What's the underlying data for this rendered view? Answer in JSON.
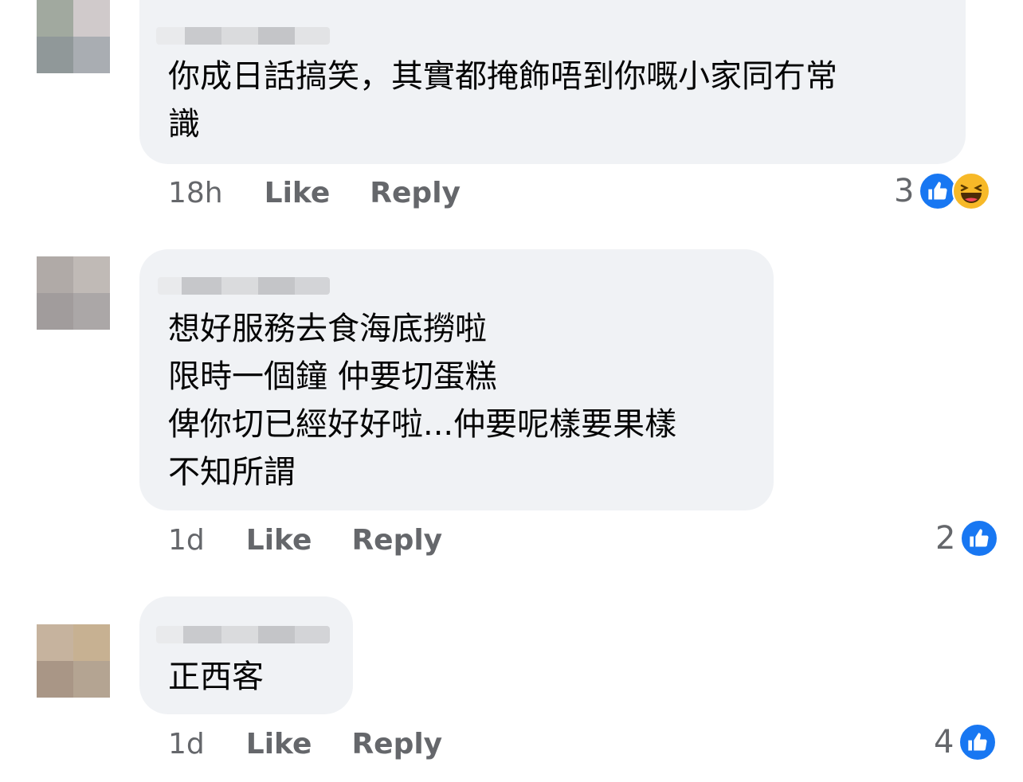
{
  "comments": [
    {
      "text": "你成日話搞笑，其實都掩飾唔到你嘅小家同冇常\n識",
      "time": "18h",
      "like_label": "Like",
      "reply_label": "Reply",
      "reaction_count": "3",
      "reactions": [
        "like-icon",
        "haha-icon"
      ]
    },
    {
      "text": "想好服務去食海底撈啦\n限時一個鐘 仲要切蛋糕\n俾你切已經好好啦...仲要呢樣要果樣\n不知所謂",
      "time": "1d",
      "like_label": "Like",
      "reply_label": "Reply",
      "reaction_count": "2",
      "reactions": [
        "like-icon"
      ]
    },
    {
      "text": "正西客",
      "time": "1d",
      "like_label": "Like",
      "reply_label": "Reply",
      "reaction_count": "4",
      "reactions": [
        "like-icon"
      ]
    }
  ],
  "colors": {
    "bubble": "#f0f2f5",
    "meta_text": "#65676b",
    "like_blue": "#1877f2",
    "haha_yellow": "#f7b928"
  }
}
